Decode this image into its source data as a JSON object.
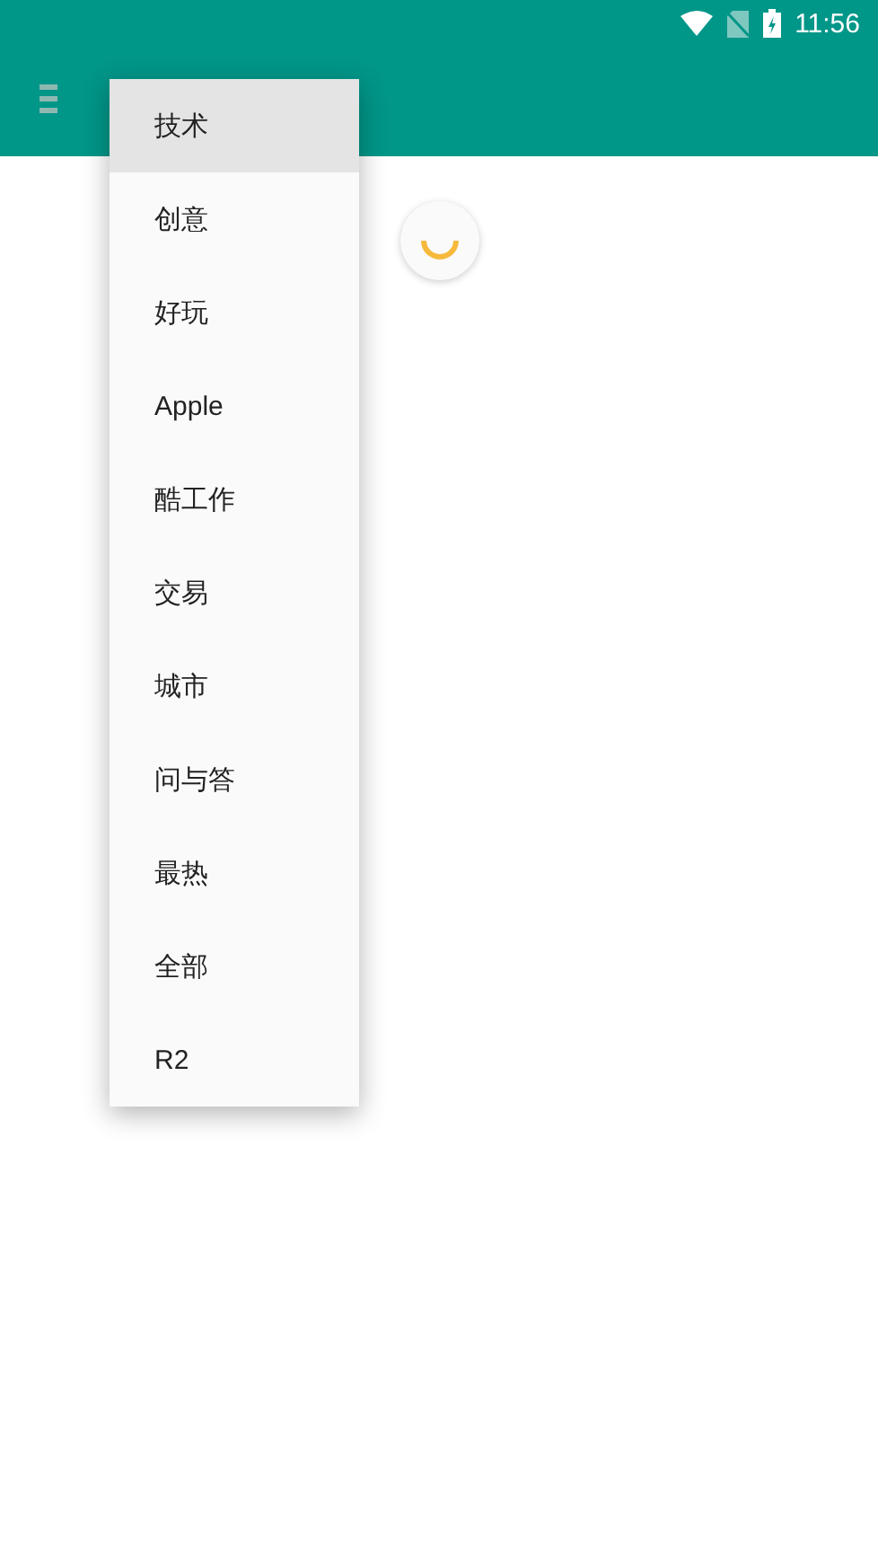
{
  "status_bar": {
    "time": "11:56"
  },
  "menu": {
    "items": [
      {
        "label": "技术",
        "selected": true
      },
      {
        "label": "创意",
        "selected": false
      },
      {
        "label": "好玩",
        "selected": false
      },
      {
        "label": "Apple",
        "selected": false
      },
      {
        "label": "酷工作",
        "selected": false
      },
      {
        "label": "交易",
        "selected": false
      },
      {
        "label": "城市",
        "selected": false
      },
      {
        "label": "问与答",
        "selected": false
      },
      {
        "label": "最热",
        "selected": false
      },
      {
        "label": "全部",
        "selected": false
      },
      {
        "label": "R2",
        "selected": false
      }
    ]
  }
}
